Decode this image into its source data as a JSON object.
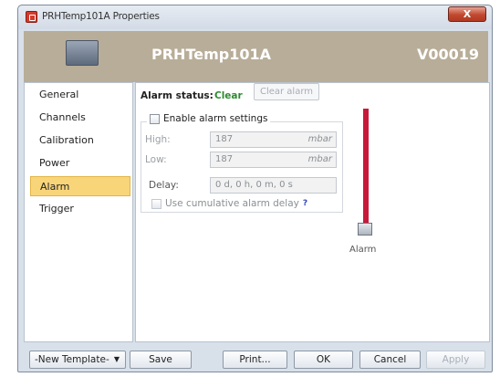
{
  "window": {
    "title": "PRHTemp101A Properties",
    "close_label": "X"
  },
  "header": {
    "device_name": "PRHTemp101A",
    "device_id": "V00019"
  },
  "sidebar": {
    "items": [
      {
        "label": "General"
      },
      {
        "label": "Channels"
      },
      {
        "label": "Calibration"
      },
      {
        "label": "Power"
      },
      {
        "label": "Alarm",
        "active": true
      },
      {
        "label": "Trigger"
      }
    ]
  },
  "alarm": {
    "status_label": "Alarm status:",
    "status_value": "Clear",
    "clear_button": "Clear alarm",
    "enable_label": "Enable alarm settings",
    "enabled": false,
    "high_label": "High:",
    "high_value": "187",
    "high_unit": "mbar",
    "low_label": "Low:",
    "low_value": "187",
    "low_unit": "mbar",
    "delay_label": "Delay:",
    "delay_value": "0 d, 0 h, 0 m, 0 s",
    "cumulative_label": "Use cumulative alarm delay",
    "help_label": "?",
    "indicator_label": "Alarm"
  },
  "footer": {
    "template_select": "-New Template-",
    "save": "Save",
    "print": "Print...",
    "ok": "OK",
    "cancel": "Cancel",
    "apply": "Apply"
  },
  "colors": {
    "accent_nav": "#f9d57a",
    "status_ok": "#2f8a32",
    "alarm_bar": "#c8193a",
    "header_bg": "#b8ad98"
  }
}
